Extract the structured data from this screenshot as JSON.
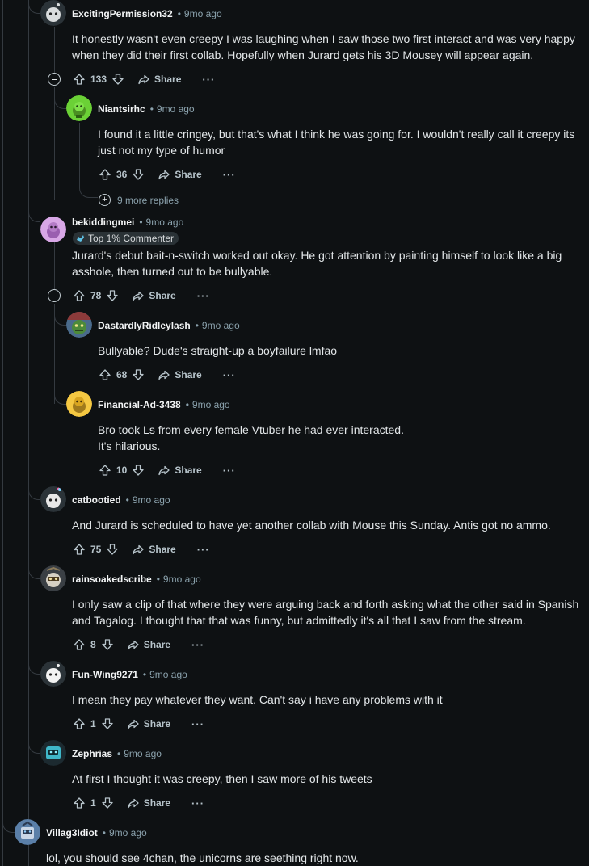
{
  "action_labels": {
    "share": "Share",
    "more": "···"
  },
  "more_replies": "9 more replies",
  "comments": [
    {
      "username": "ExcitingPermission32",
      "time": "9mo ago",
      "text": "It honestly wasn't even creepy I was laughing when I saw those two first interact and was very happy when they did their first collab. Hopefully when Jurard gets his 3D Mousey will appear again.",
      "votes": "133"
    },
    {
      "username": "Niantsirhc",
      "time": "9mo ago",
      "text": "I found it a little cringey, but that's what I think he was going for. I wouldn't really call it creepy its just not my type of humor",
      "votes": "36"
    },
    {
      "username": "bekiddingmei",
      "time": "9mo ago",
      "badge": "Top 1% Commenter",
      "text": "Jurard's debut bait-n-switch worked out okay. He got attention by painting himself to look like a big asshole, then turned out to be bullyable.",
      "votes": "78"
    },
    {
      "username": "DastardlyRidleylash",
      "time": "9mo ago",
      "text": "Bullyable? Dude's straight-up a boyfailure lmfao",
      "votes": "68"
    },
    {
      "username": "Financial-Ad-3438",
      "time": "9mo ago",
      "text1": "Bro took Ls from every female Vtuber he had ever interacted.",
      "text2": "It's hilarious.",
      "votes": "10"
    },
    {
      "username": "catbootied",
      "time": "9mo ago",
      "text": "And Jurard is scheduled to have yet another collab with Mouse this Sunday. Antis got no ammo.",
      "votes": "75"
    },
    {
      "username": "rainsoakedscribe",
      "time": "9mo ago",
      "text": "I only saw a clip of that where they were arguing back and forth asking what the other said in Spanish and Tagalog. I thought that that was funny, but admittedly it's all that I saw from the stream.",
      "votes": "8"
    },
    {
      "username": "Fun-Wing9271",
      "time": "9mo ago",
      "text": "I mean they pay whatever they want. Can't say i have any problems with it",
      "votes": "1"
    },
    {
      "username": "Zephrias",
      "time": "9mo ago",
      "text": "At first I thought it was creepy, then I saw more of his tweets",
      "votes": "1"
    },
    {
      "username": "Villag3Idiot",
      "time": "9mo ago",
      "text": "lol, you should see 4chan, the unicorns are seething right now."
    }
  ]
}
